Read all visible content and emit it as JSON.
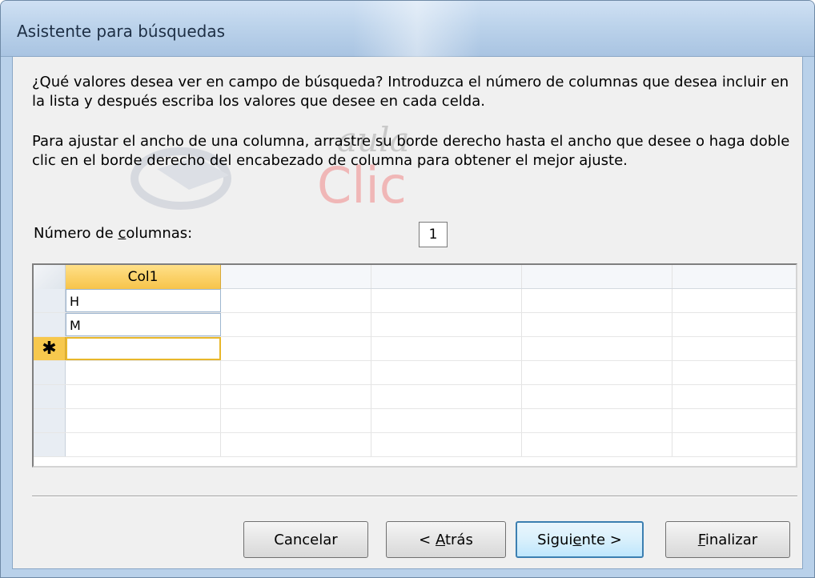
{
  "window": {
    "title": "Asistente para búsquedas"
  },
  "instructions": {
    "para1": "¿Qué valores desea ver en campo de búsqueda? Introduzca el número de columnas que desea incluir en la lista y después escriba los valores que desee en cada celda.",
    "para2": "Para ajustar el ancho de una columna, arrastre su borde derecho hasta el ancho que desee o haga doble clic en el borde derecho del encabezado de columna para obtener el mejor ajuste."
  },
  "watermark": {
    "text1": "aula",
    "text2": "Clic"
  },
  "columns": {
    "label_prefix": "Número de ",
    "label_accel": "c",
    "label_suffix": "olumnas:",
    "value": "1"
  },
  "grid": {
    "header": "Col1",
    "rows": [
      "H",
      "M"
    ],
    "new_row_symbol": "✱"
  },
  "buttons": {
    "cancel": "Cancelar",
    "back_prefix": "< ",
    "back_accel": "A",
    "back_suffix": "trás",
    "next_prefix": "Sigui",
    "next_accel": "e",
    "next_suffix": "nte >",
    "finish_accel": "F",
    "finish_suffix": "inalizar"
  },
  "colors": {
    "accent": "#f7c44a",
    "titlebar": "#bcd3eb"
  }
}
